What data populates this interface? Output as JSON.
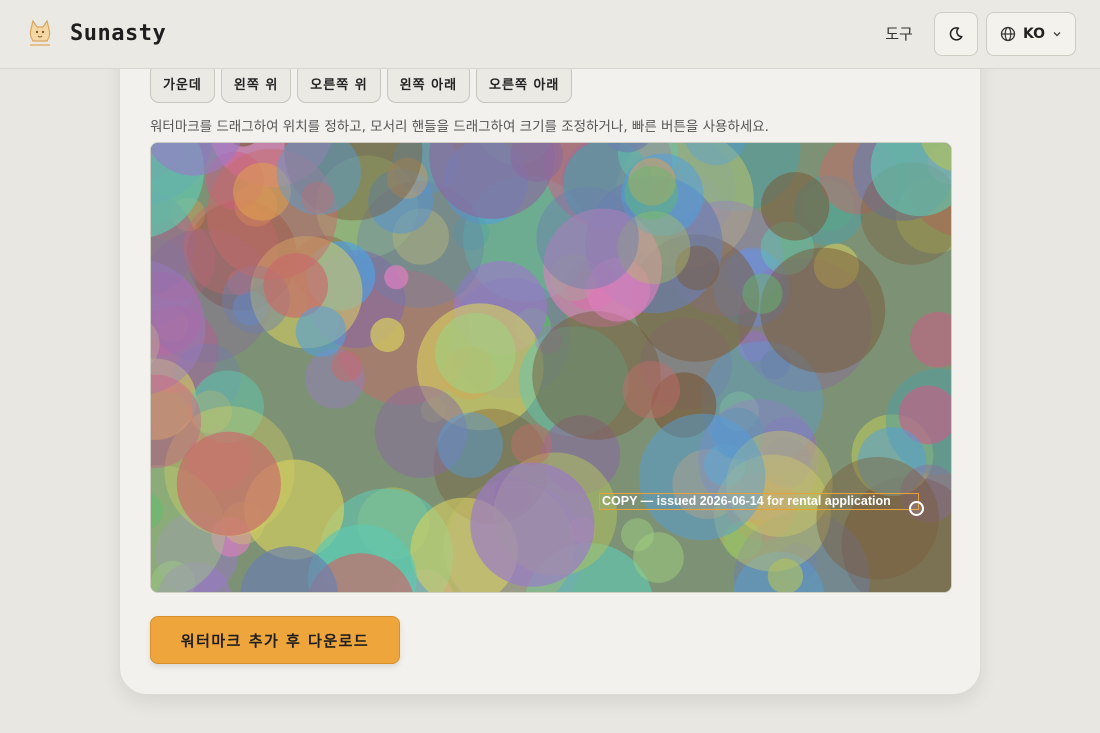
{
  "header": {
    "brand_name": "Sunasty",
    "nav_tools_label": "도구",
    "lang_label": "KO"
  },
  "position_buttons": [
    "가운데",
    "왼쪽 위",
    "오른쪽 위",
    "왼쪽 아래",
    "오른쪽 아래"
  ],
  "hint_text": "워터마크를 드래그하여 위치를 정하고, 모서리 핸들을 드래그하여 크기를 조정하거나, 빠른 버튼을 사용하세요.",
  "watermark": {
    "text": "COPY — issued 2026-06-14 for rental application"
  },
  "download_button_label": "워터마크 추가 후 다운로드",
  "colors": {
    "accent": "#eea63c",
    "watermark_border": "#e8a038",
    "background": "#e9e7e1",
    "card": "#f2f1ed"
  },
  "icons": {
    "logo": "cat-logo-icon",
    "theme": "moon-icon",
    "language": "globe-icon",
    "dropdown": "chevron-down-icon",
    "resize": "resize-handle-icon"
  }
}
